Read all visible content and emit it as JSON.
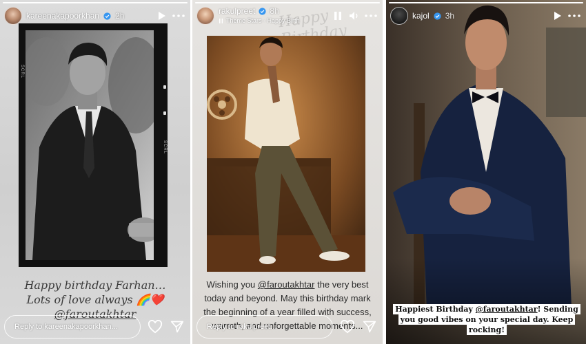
{
  "stories": [
    {
      "username": "kareenakapoorkhan",
      "time": "2h",
      "caption_lines": [
        "Happy birthday Farhan…",
        "Lots of love always 🌈❤️"
      ],
      "caption_mention": "@faroutakhtar",
      "reply_placeholder": "Reply to kareenakapoorkhan...",
      "film_side_text": "SCRL"
    },
    {
      "username": "rakulpreet",
      "time": "8h",
      "music_label": "Theme Stars · Happy Birth",
      "background_script": "Happy Birthday",
      "caption_prefix": "Wishing you ",
      "caption_mention": "@faroutakhtar",
      "caption_rest": " the very best today and beyond. May this birthday mark the beginning of a year filled with success, warmth, and unforgettable moments...",
      "reply_placeholder": "Reply to rakulpreet..."
    },
    {
      "username": "kajol",
      "time": "3h",
      "caption_prefix": "Happiest Birthday ",
      "caption_mention": "@faroutakhtar",
      "caption_rest": "! Sending you good vibes on your special day. Keep rocking!"
    }
  ],
  "icons": {
    "verified": "verified-badge-icon",
    "play": "play-icon",
    "pause": "pause-icon",
    "mute": "speaker-icon",
    "more": "more-icon",
    "like": "heart-icon",
    "share": "send-icon",
    "music": "music-note-icon"
  },
  "colors": {
    "verified_blue": "#3897f0",
    "white": "#ffffff"
  }
}
